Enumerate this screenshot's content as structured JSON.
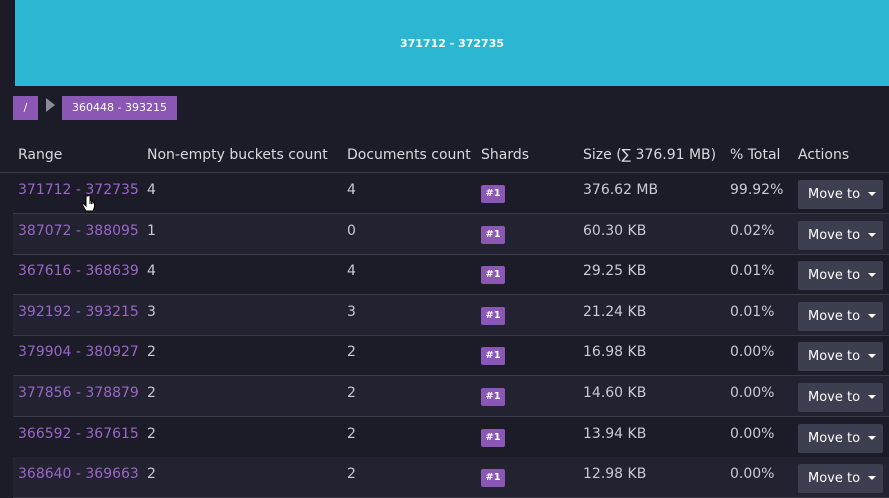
{
  "treemap": {
    "label": "371712 - 372735",
    "color": "#2bb6d1"
  },
  "breadcrumb": {
    "root": "/",
    "current": "360448 - 393215"
  },
  "table": {
    "headers": {
      "range": "Range",
      "buckets": "Non-empty buckets count",
      "docs": "Documents count",
      "shards": "Shards",
      "size": "Size (∑ 376.91 MB)",
      "pct": "% Total",
      "actions": "Actions"
    },
    "rows": [
      {
        "range": "371712 - 372735",
        "buckets": "4",
        "docs": "4",
        "shard": "#1",
        "size": "376.62 MB",
        "pct": "99.92%",
        "action": "Move to"
      },
      {
        "range": "387072 - 388095",
        "buckets": "1",
        "docs": "0",
        "shard": "#1",
        "size": "60.30 KB",
        "pct": "0.02%",
        "action": "Move to"
      },
      {
        "range": "367616 - 368639",
        "buckets": "4",
        "docs": "4",
        "shard": "#1",
        "size": "29.25 KB",
        "pct": "0.01%",
        "action": "Move to"
      },
      {
        "range": "392192 - 393215",
        "buckets": "3",
        "docs": "3",
        "shard": "#1",
        "size": "21.24 KB",
        "pct": "0.01%",
        "action": "Move to"
      },
      {
        "range": "379904 - 380927",
        "buckets": "2",
        "docs": "2",
        "shard": "#1",
        "size": "16.98 KB",
        "pct": "0.00%",
        "action": "Move to"
      },
      {
        "range": "377856 - 378879",
        "buckets": "2",
        "docs": "2",
        "shard": "#1",
        "size": "14.60 KB",
        "pct": "0.00%",
        "action": "Move to"
      },
      {
        "range": "366592 - 367615",
        "buckets": "2",
        "docs": "2",
        "shard": "#1",
        "size": "13.94 KB",
        "pct": "0.00%",
        "action": "Move to"
      },
      {
        "range": "368640 - 369663",
        "buckets": "2",
        "docs": "2",
        "shard": "#1",
        "size": "12.98 KB",
        "pct": "0.00%",
        "action": "Move to"
      }
    ]
  }
}
